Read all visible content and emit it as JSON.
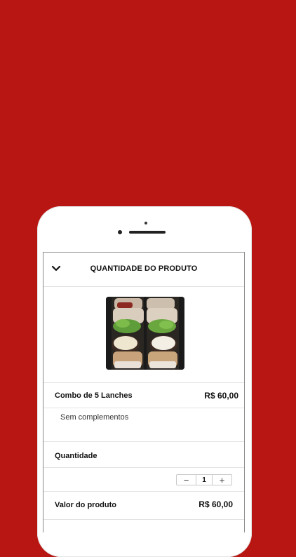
{
  "colors": {
    "background": "#b81612",
    "phone": "#ffffff",
    "text": "#111111"
  },
  "header": {
    "title": "QUANTIDADE DO PRODUTO",
    "back_icon": "chevron-down-icon"
  },
  "product": {
    "name": "Combo de 5 Lanches",
    "price": "R$ 60,00",
    "complements": "Sem complementos"
  },
  "quantity": {
    "label": "Quantidade",
    "value": "1",
    "decrement": "−",
    "increment": "+"
  },
  "total": {
    "label": "Valor do produto",
    "price": "R$ 60,00"
  }
}
